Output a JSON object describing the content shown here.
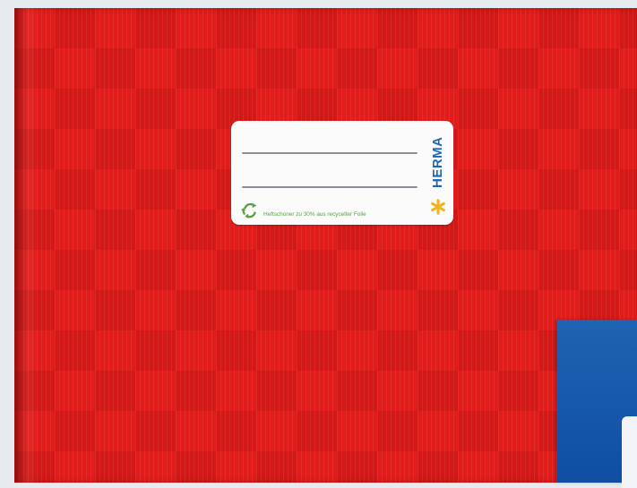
{
  "label": {
    "brand": "HERMA",
    "footnote": "Heftschoner zu 30% aus recycelter Folie"
  },
  "colors": {
    "cover": "#e11d1b",
    "brand": "#1c67b3",
    "star": "#f5b21a",
    "recycle": "#59a244",
    "blue_sheet": "#1a5cad"
  }
}
